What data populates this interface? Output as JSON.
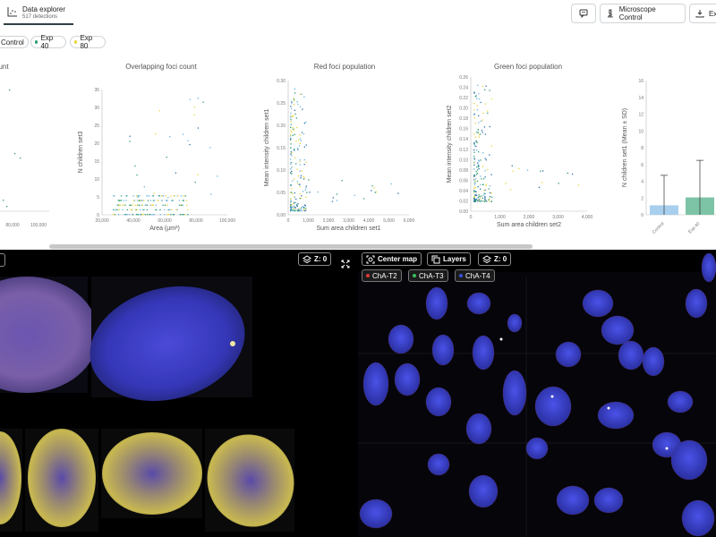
{
  "header": {
    "tab_title": "Data explorer",
    "tab_subtitle": "517 detections",
    "microscope_label": "Microscope Control",
    "export_label": "Ex"
  },
  "filters": [
    {
      "label": "Control",
      "color": "#6bb3e0"
    },
    {
      "label": "Exp 40",
      "color": "#2e9c73"
    },
    {
      "label": "Exp 80",
      "color": "#e8d43a"
    }
  ],
  "charts": {
    "c1": {
      "title": "unt",
      "ticks_x": [
        "80,000",
        "100,000"
      ]
    },
    "c2": {
      "title": "Overlapping foci count",
      "xlabel": "Area (µm²)",
      "ylabel": "N children set3",
      "ticks_x": [
        "20,000",
        "40,000",
        "60,000",
        "80,000",
        "100,000"
      ],
      "ticks_y": [
        "0",
        "5",
        "10",
        "15",
        "20",
        "25",
        "30",
        "35"
      ]
    },
    "c3": {
      "title": "Red foci population",
      "xlabel": "Sum area children set1",
      "ylabel": "Mean intensity children set1",
      "ticks_x": [
        "0",
        "1,000",
        "2,000",
        "3,000",
        "4,000",
        "5,000",
        "6,000"
      ],
      "ticks_y": [
        "0.00",
        "0.05",
        "0.10",
        "0.15",
        "0.20",
        "0.25",
        "0.30"
      ]
    },
    "c4": {
      "title": "Green foci population",
      "xlabel": "Sum area children set2",
      "ylabel": "Mean intensity children set2",
      "ticks_x": [
        "0",
        "1,000",
        "2,000",
        "3,000",
        "4,000"
      ],
      "ticks_y": [
        "0.00",
        "0.02",
        "0.04",
        "0.06",
        "0.08",
        "0.10",
        "0.12",
        "0.14",
        "0.16",
        "0.18",
        "0.20",
        "0.22",
        "0.24",
        "0.26"
      ]
    },
    "c5": {
      "ylabel": "N children set1 (Mean ± SD)",
      "ticks_y": [
        "0",
        "2",
        "4",
        "6",
        "8",
        "10",
        "12",
        "14",
        "16"
      ],
      "ticks_x": [
        "Control",
        "Exp 40"
      ]
    }
  },
  "viewer": {
    "left_z": "Z: 0",
    "center_map": "Center map",
    "layers": "Layers",
    "right_z": "Z: 0",
    "channels": [
      {
        "label": "ChA-T2",
        "color": "#e03a3a"
      },
      {
        "label": "ChA-T3",
        "color": "#35c25a"
      },
      {
        "label": "ChA-T4",
        "color": "#3a4ee0"
      }
    ]
  },
  "chart_data": [
    {
      "type": "scatter",
      "title": "Overlapping foci count",
      "xlabel": "Area (µm²)",
      "ylabel": "N children set3",
      "xlim": [
        0,
        100000
      ],
      "ylim": [
        0,
        35
      ]
    },
    {
      "type": "scatter",
      "title": "Red foci population",
      "xlabel": "Sum area children set1",
      "ylabel": "Mean intensity children set1",
      "xlim": [
        0,
        6000
      ],
      "ylim": [
        0,
        0.3
      ]
    },
    {
      "type": "scatter",
      "title": "Green foci population",
      "xlabel": "Sum area children set2",
      "ylabel": "Mean intensity children set2",
      "xlim": [
        0,
        4000
      ],
      "ylim": [
        0,
        0.26
      ]
    },
    {
      "type": "bar",
      "ylabel": "N children set1 (Mean ± SD)",
      "categories": [
        "Control",
        "Exp 40"
      ],
      "values": [
        1.2,
        2.2
      ],
      "errors": [
        3.8,
        4.7
      ],
      "ylim": [
        0,
        17
      ]
    }
  ]
}
